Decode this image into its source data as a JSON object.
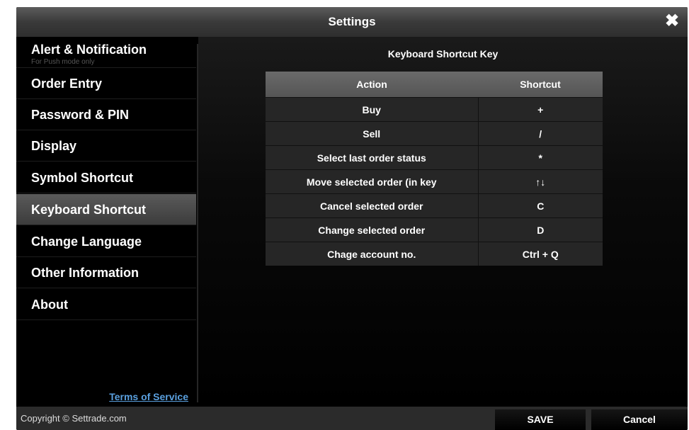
{
  "dialog": {
    "title": "Settings",
    "close_icon": "close-icon"
  },
  "sidebar": {
    "items": [
      {
        "label": "Alert & Notification",
        "sublabel": "For Push mode only"
      },
      {
        "label": "Order Entry"
      },
      {
        "label": "Password & PIN"
      },
      {
        "label": "Display"
      },
      {
        "label": "Symbol Shortcut"
      },
      {
        "label": "Keyboard Shortcut",
        "active": true
      },
      {
        "label": "Change Language"
      },
      {
        "label": "Other Information"
      },
      {
        "label": "About"
      }
    ],
    "terms_link": "Terms of Service"
  },
  "content": {
    "title": "Keyboard Shortcut Key",
    "table": {
      "headers": [
        "Action",
        "Shortcut"
      ],
      "rows": [
        {
          "action": "Buy",
          "shortcut": "+"
        },
        {
          "action": "Sell",
          "shortcut": "/"
        },
        {
          "action": "Select last order status",
          "shortcut": "*"
        },
        {
          "action": "Move selected order (in key",
          "shortcut": "↑↓"
        },
        {
          "action": "Cancel selected order",
          "shortcut": "C"
        },
        {
          "action": "Change selected order",
          "shortcut": "D"
        },
        {
          "action": "Chage account no.",
          "shortcut": "Ctrl + Q"
        }
      ]
    }
  },
  "footer": {
    "copyright": "Copyright © Settrade.com",
    "save_label": "SAVE",
    "cancel_label": "Cancel"
  }
}
